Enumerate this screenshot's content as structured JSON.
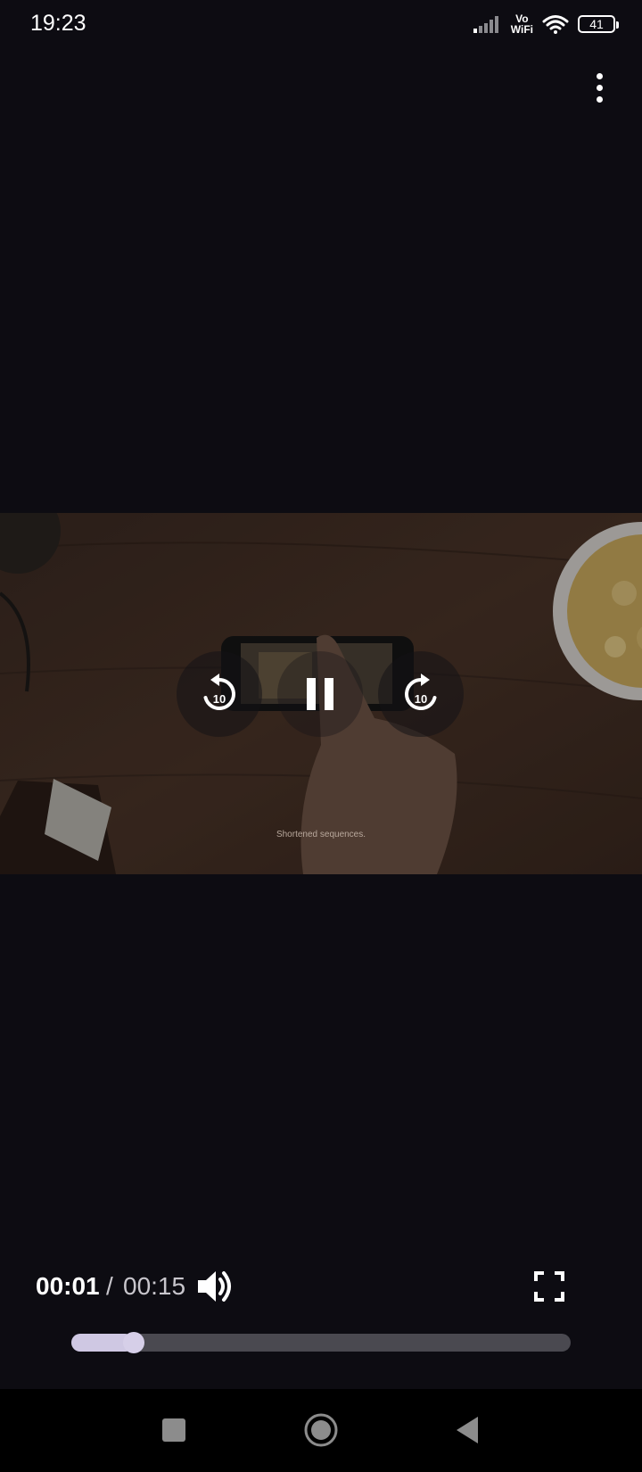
{
  "status_bar": {
    "time": "19:23",
    "network_label_top": "Vo",
    "network_label_bottom": "WiFi",
    "battery_level": "41",
    "icons": [
      "signal-icon",
      "wifi-icon",
      "battery-icon"
    ]
  },
  "top_menu": {
    "icon": "more-vertical-icon"
  },
  "video": {
    "caption": "Shortened sequences.",
    "controls": {
      "replay_icon": "replay-10-icon",
      "replay_seconds": "10",
      "pause_icon": "pause-icon",
      "forward_icon": "forward-10-icon",
      "forward_seconds": "10"
    }
  },
  "playback": {
    "current_time": "00:01",
    "separator": "/",
    "total_time": "00:15",
    "progress_percent": 12.5,
    "volume_icon": "volume-up-icon",
    "fullscreen_icon": "fullscreen-icon"
  },
  "nav_bar": {
    "recents_icon": "square-icon",
    "home_icon": "circle-icon",
    "back_icon": "triangle-back-icon"
  },
  "colors": {
    "background": "#0d0c12",
    "seek_fill": "#cfc8e3",
    "seek_track": "#4a4950",
    "nav_bar": "#000000"
  }
}
